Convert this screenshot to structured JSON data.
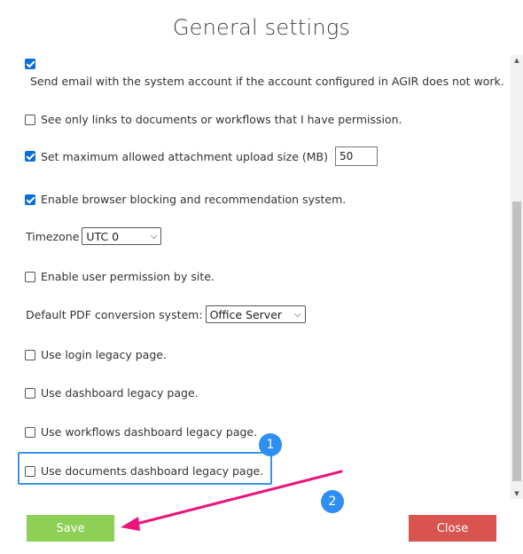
{
  "dialog": {
    "title": "General settings"
  },
  "settings": {
    "send_email_label": "Send email with the system account if the account configured in AGIR does not work.",
    "links_permission_label": "See only links to documents or workflows that I have permission.",
    "max_upload_label": "Set maximum allowed attachment upload size (MB)",
    "max_upload_value": "50",
    "browser_blocking_label": "Enable browser blocking and recommendation system.",
    "timezone_label": "Timezone",
    "timezone_value": "UTC 0",
    "user_permission_site_label": "Enable user permission by site.",
    "pdf_conversion_label": "Default PDF conversion system:",
    "pdf_conversion_value": "Office Server",
    "login_legacy_label": "Use login legacy page.",
    "dashboard_legacy_label": "Use dashboard legacy page.",
    "workflows_dashboard_legacy_label": "Use workflows dashboard legacy page.",
    "documents_dashboard_legacy_label": "Use documents dashboard legacy page."
  },
  "checked": {
    "send_email": true,
    "links_permission": false,
    "max_upload": true,
    "browser_blocking": true,
    "user_permission_site": false,
    "login_legacy": false,
    "dashboard_legacy": false,
    "workflows_dashboard_legacy": false,
    "documents_dashboard_legacy": false
  },
  "footer": {
    "save_label": "Save",
    "close_label": "Close"
  },
  "annotations": {
    "step1": "1",
    "step2": "2"
  },
  "colors": {
    "checkbox_checked": "#0b6fd6",
    "save": "#8ecf55",
    "close": "#d9534f",
    "highlight": "#3a92e8",
    "arrow": "#e8157a"
  }
}
